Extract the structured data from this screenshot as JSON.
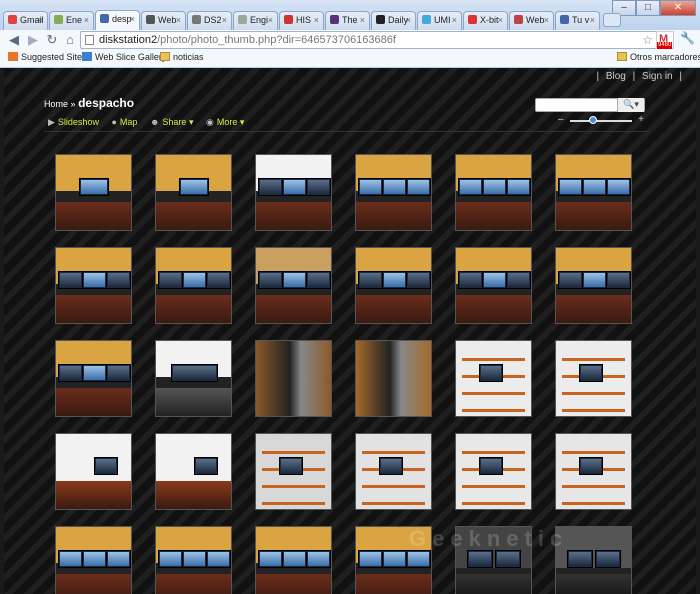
{
  "browser": {
    "tabs": [
      {
        "label": "Gmail",
        "color": "#d44"
      },
      {
        "label": "Ene",
        "color": "#8a5"
      },
      {
        "label": "desp",
        "color": "#46a",
        "active": true
      },
      {
        "label": "Web",
        "color": "#555"
      },
      {
        "label": "DS2",
        "color": "#777"
      },
      {
        "label": "Engi",
        "color": "#9a9"
      },
      {
        "label": "HIS",
        "color": "#c33"
      },
      {
        "label": "The",
        "color": "#537"
      },
      {
        "label": "Daily",
        "color": "#222"
      },
      {
        "label": "UMI",
        "color": "#4ad"
      },
      {
        "label": "X-bit",
        "color": "#d33"
      },
      {
        "label": "Web",
        "color": "#b44"
      },
      {
        "label": "Tu v",
        "color": "#46a"
      }
    ],
    "url_host": "diskstation2",
    "url_path": "/photo/photo_thumb.php?dir=646573706163686f",
    "gmail_badge": "9480",
    "bookmarks": [
      "Suggested Sites",
      "Web Slice Gallery",
      "noticias"
    ],
    "other_bookmarks": "Otros marcadores"
  },
  "page": {
    "toplinks": [
      "|",
      "Blog",
      "|",
      "Sign in",
      "|"
    ],
    "breadcrumb_home": "Home",
    "breadcrumb_sep": "»",
    "album_title": "despacho",
    "actions": [
      {
        "label": "Slideshow",
        "icon": "play-icon"
      },
      {
        "label": "Map",
        "icon": "map-pin-icon"
      },
      {
        "label": "Share",
        "icon": "person-icon"
      },
      {
        "label": "More",
        "icon": "globe-icon"
      }
    ],
    "search_placeholder": "",
    "watermark": "Geeknetic"
  },
  "thumbnails": [
    {
      "scene": "desk-single",
      "wall": "#d9a441"
    },
    {
      "scene": "desk-single",
      "wall": "#d9a441"
    },
    {
      "scene": "desk-triple",
      "wall": "#f2f2f2"
    },
    {
      "scene": "desk-triple-blue",
      "wall": "#d9a441"
    },
    {
      "scene": "desk-triple-blue",
      "wall": "#d9a441"
    },
    {
      "scene": "desk-triple-blue",
      "wall": "#d9a441"
    },
    {
      "scene": "desk-triple",
      "wall": "#d9a441"
    },
    {
      "scene": "desk-triple",
      "wall": "#d9a441"
    },
    {
      "scene": "desk-triple",
      "wall": "#c9a060"
    },
    {
      "scene": "desk-triple",
      "wall": "#d9a441"
    },
    {
      "scene": "desk-triple",
      "wall": "#d9a441"
    },
    {
      "scene": "desk-triple",
      "wall": "#d9a441"
    },
    {
      "scene": "desk-triple",
      "wall": "#d9a441"
    },
    {
      "scene": "desk-wide",
      "wall": "#f2f2f2"
    },
    {
      "scene": "closeup",
      "wall": "#8a5a2a"
    },
    {
      "scene": "closeup",
      "wall": "#a56a2a"
    },
    {
      "scene": "shelves",
      "wall": "#ececec"
    },
    {
      "scene": "shelves",
      "wall": "#ececec"
    },
    {
      "scene": "room",
      "wall": "#f2f2f2"
    },
    {
      "scene": "room",
      "wall": "#f2f2f2"
    },
    {
      "scene": "shelves",
      "wall": "#d8d8d8"
    },
    {
      "scene": "shelves",
      "wall": "#e2e2e2"
    },
    {
      "scene": "shelves",
      "wall": "#e8e8e8"
    },
    {
      "scene": "shelves",
      "wall": "#e6e6e6"
    },
    {
      "scene": "desk-triple-blue",
      "wall": "#d9a441"
    },
    {
      "scene": "desk-triple-blue",
      "wall": "#d9a441"
    },
    {
      "scene": "desk-triple-blue",
      "wall": "#d9a441"
    },
    {
      "scene": "desk-triple-blue",
      "wall": "#d9a441"
    },
    {
      "scene": "desk-dark",
      "wall": "#444"
    },
    {
      "scene": "desk-dark",
      "wall": "#555"
    }
  ]
}
